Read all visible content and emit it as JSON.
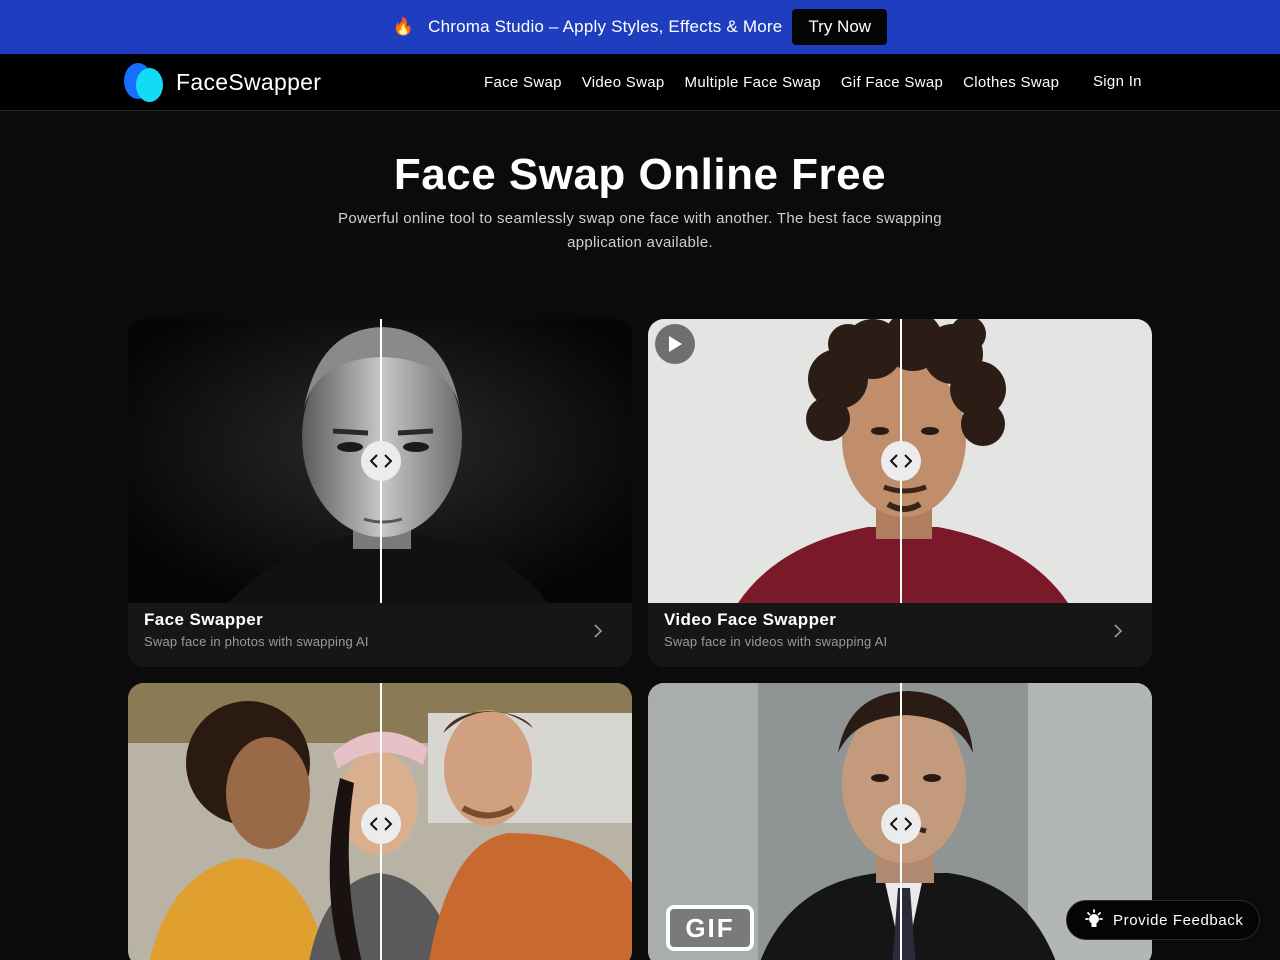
{
  "promo": {
    "fire_icon": "🔥",
    "text": "Chroma Studio – Apply Styles, Effects & More",
    "button_label": "Try Now"
  },
  "nav": {
    "logo_text": "FaceSwapper",
    "links": [
      "Face Swap",
      "Video Swap",
      "Multiple Face Swap",
      "Gif Face Swap",
      "Clothes Swap"
    ],
    "signin_label": "Sign In"
  },
  "hero": {
    "title": "Face Swap Online Free",
    "subtitle": "Powerful online tool to seamlessly swap one face with another. The best face swapping application available."
  },
  "cards": [
    {
      "title": "Face Swapper",
      "description": "Swap face in photos with swapping AI"
    },
    {
      "title": "Video Face Swapper",
      "description": "Swap face in videos with swapping AI"
    },
    {
      "title": "",
      "description": ""
    },
    {
      "title": "",
      "description": ""
    }
  ],
  "gif_badge": "GIF",
  "feedback": {
    "label": "Provide  Feedback"
  },
  "colors": {
    "promo_bg": "#1f3ebf",
    "page_bg": "#0b0b0b",
    "logo_blue": "#1570ff",
    "logo_cyan": "#12dcf5"
  },
  "icons": [
    "fire-icon",
    "play-icon",
    "compare-handle-icon",
    "chevron-right-icon",
    "lightbulb-icon"
  ]
}
